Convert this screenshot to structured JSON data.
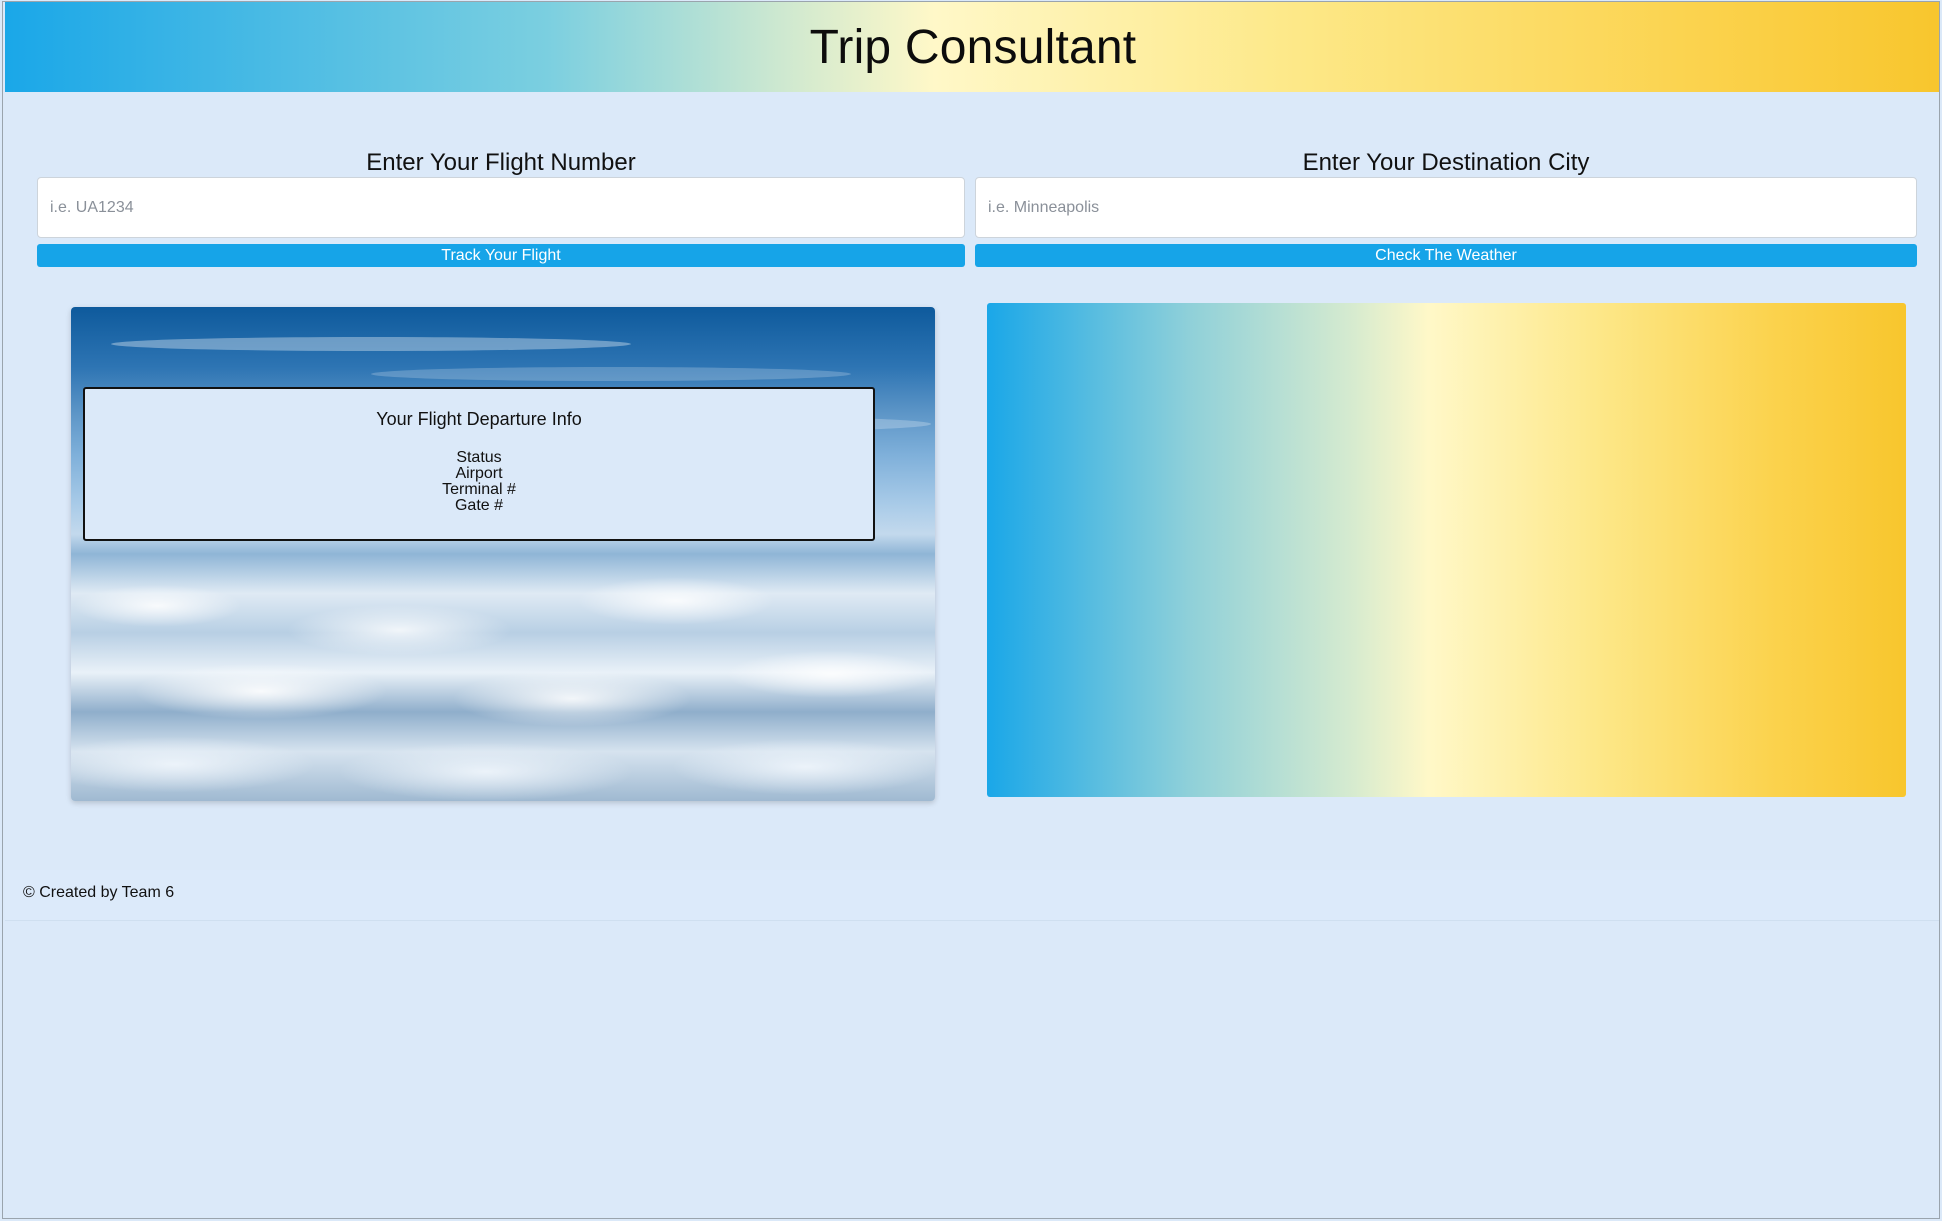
{
  "header": {
    "title": "Trip Consultant"
  },
  "flight": {
    "heading": "Enter Your Flight Number",
    "placeholder": "i.e. UA1234",
    "value": "",
    "button_label": "Track Your Flight"
  },
  "weather": {
    "heading": "Enter Your Destination City",
    "placeholder": "i.e. Minneapolis",
    "value": "",
    "button_label": "Check The Weather"
  },
  "departure_info": {
    "title": "Your Flight Departure Info",
    "fields": [
      "Status",
      "Airport",
      "Terminal #",
      "Gate #"
    ]
  },
  "footer": {
    "text": "© Created by Team 6"
  },
  "colors": {
    "page_background": "#dbe9f9",
    "button": "#16a4e8",
    "gradient_start": "#1aa7e8",
    "gradient_mid": "#fff8c8",
    "gradient_end": "#f8c62d"
  },
  "icons": {
    "background_image": "sky-clouds-image"
  }
}
